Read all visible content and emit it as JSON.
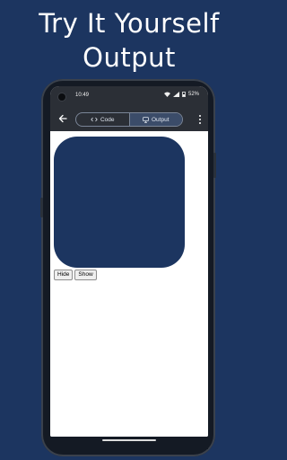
{
  "promo": {
    "line1": "Try It Yourself",
    "line2": "Output"
  },
  "status_bar": {
    "time": "10:49",
    "battery": "52%"
  },
  "toolbar": {
    "tabs": [
      {
        "label": "Code",
        "icon": "code-icon",
        "active": false
      },
      {
        "label": "Output",
        "icon": "display-icon",
        "active": true
      }
    ]
  },
  "output": {
    "square_color": "#1c3560",
    "buttons": {
      "hide": "Hide",
      "show": "Show"
    }
  },
  "colors": {
    "background": "#1c3560",
    "toolbar": "#2b2f36",
    "active_tab": "#3b4c69"
  }
}
